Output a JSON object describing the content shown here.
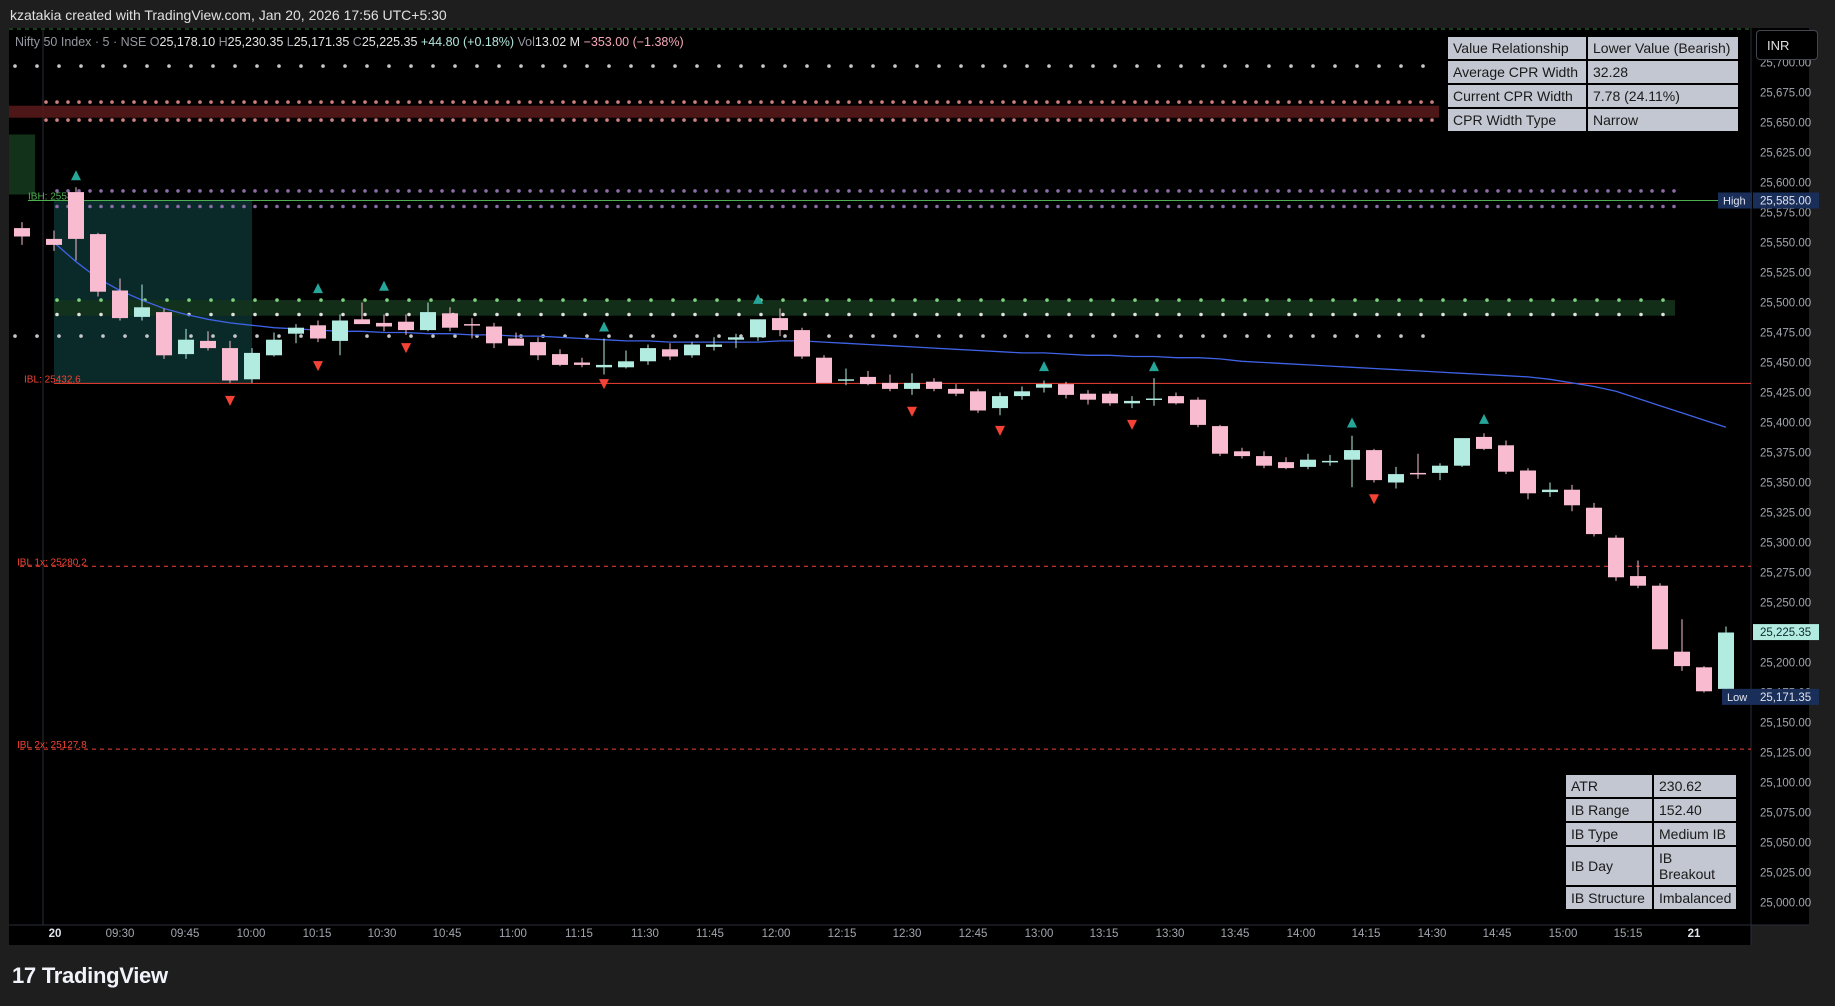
{
  "attribution": "kzatakia created with TradingView.com, Jan 20, 2026 17:56 UTC+5:30",
  "brand": "TradingView",
  "currency_button": "INR",
  "legend": {
    "symbol": "Nifty 50 Index · 5 · NSE",
    "o_label": "O",
    "o": "25,178.10",
    "h_label": "H",
    "h": "25,230.35",
    "l_label": "L",
    "l": "25,171.35",
    "c_label": "C",
    "c": "25,225.35",
    "change": "+44.80 (+0.18%)",
    "vol_label": "Vol",
    "vol": "13.02 M",
    "vol_change": "−353.00 (−1.38%)"
  },
  "cpr_table": [
    {
      "key": "Value Relationship",
      "value": "Lower Value (Bearish)"
    },
    {
      "key": "Average CPR Width",
      "value": "32.28"
    },
    {
      "key": "Current CPR Width",
      "value": "7.78 (24.11%)"
    },
    {
      "key": "CPR Width Type",
      "value": "Narrow"
    }
  ],
  "ib_table": [
    {
      "key": "ATR",
      "value": "230.62"
    },
    {
      "key": "IB Range",
      "value": "152.40"
    },
    {
      "key": "IB Type",
      "value": "Medium IB"
    },
    {
      "key": "IB Day",
      "value": "IB Breakout"
    },
    {
      "key": "IB Structure",
      "value": "Imbalanced"
    }
  ],
  "colors": {
    "background": "#000000",
    "up_candle": "#b2ebe0",
    "down_candle": "#f8bbd0",
    "ema": "#3f63e6",
    "ib_high": "#4caf50",
    "ib_low": "#f44336",
    "buy_arrow": "#26a69a",
    "sell_arrow": "#f44336",
    "ib_box": "#0d3838"
  },
  "chart_data": {
    "type": "candlestick",
    "symbol": "Nifty 50 Index",
    "interval": "5",
    "exchange": "NSE",
    "y_axis_ticks": [
      "25,700.00",
      "25,675.00",
      "25,650.00",
      "25,625.00",
      "25,600.00",
      "25,575.00",
      "25,550.00",
      "25,525.00",
      "25,500.00",
      "25,475.00",
      "25,450.00",
      "25,425.00",
      "25,400.00",
      "25,375.00",
      "25,350.00",
      "25,325.00",
      "25,300.00",
      "25,275.00",
      "25,250.00",
      "25,225.00",
      "25,200.00",
      "25,175.00",
      "25,150.00",
      "25,125.00",
      "25,100.00",
      "25,075.00",
      "25,050.00",
      "25,025.00",
      "25,000.00"
    ],
    "ylim": [
      24995,
      25725
    ],
    "x_axis_ticks": [
      "20",
      "09:30",
      "09:45",
      "10:00",
      "10:15",
      "10:30",
      "10:45",
      "11:00",
      "11:15",
      "11:30",
      "11:45",
      "12:00",
      "12:15",
      "12:30",
      "12:45",
      "13:00",
      "13:15",
      "13:30",
      "13:45",
      "14:00",
      "14:15",
      "14:30",
      "14:45",
      "15:00",
      "15:15",
      "21"
    ],
    "candles": [
      {
        "o": 25562,
        "h": 25567,
        "l": 25548,
        "c": 25555
      },
      {
        "o": 25553,
        "h": 25560,
        "l": 25543,
        "c": 25548
      },
      {
        "o": 25592,
        "h": 25596,
        "l": 25535,
        "c": 25553
      },
      {
        "o": 25557,
        "h": 25558,
        "l": 25505,
        "c": 25509
      },
      {
        "o": 25510,
        "h": 25520,
        "l": 25485,
        "c": 25487
      },
      {
        "o": 25488,
        "h": 25515,
        "l": 25485,
        "c": 25496
      },
      {
        "o": 25492,
        "h": 25495,
        "l": 25453,
        "c": 25456
      },
      {
        "o": 25457,
        "h": 25478,
        "l": 25453,
        "c": 25469
      },
      {
        "o": 25468,
        "h": 25476,
        "l": 25460,
        "c": 25462
      },
      {
        "o": 25462,
        "h": 25468,
        "l": 25433,
        "c": 25435
      },
      {
        "o": 25436,
        "h": 25462,
        "l": 25433,
        "c": 25458
      },
      {
        "o": 25456,
        "h": 25475,
        "l": 25455,
        "c": 25469
      },
      {
        "o": 25474,
        "h": 25482,
        "l": 25466,
        "c": 25479
      },
      {
        "o": 25481,
        "h": 25485,
        "l": 25467,
        "c": 25470
      },
      {
        "o": 25468,
        "h": 25490,
        "l": 25456,
        "c": 25485
      },
      {
        "o": 25486,
        "h": 25500,
        "l": 25485,
        "c": 25482
      },
      {
        "o": 25483,
        "h": 25490,
        "l": 25476,
        "c": 25480
      },
      {
        "o": 25484,
        "h": 25490,
        "l": 25473,
        "c": 25477
      },
      {
        "o": 25477,
        "h": 25500,
        "l": 25476,
        "c": 25492
      },
      {
        "o": 25491,
        "h": 25496,
        "l": 25476,
        "c": 25479
      },
      {
        "o": 25482,
        "h": 25487,
        "l": 25470,
        "c": 25481
      },
      {
        "o": 25480,
        "h": 25483,
        "l": 25462,
        "c": 25466
      },
      {
        "o": 25470,
        "h": 25475,
        "l": 25465,
        "c": 25464
      },
      {
        "o": 25467,
        "h": 25471,
        "l": 25452,
        "c": 25456
      },
      {
        "o": 25457,
        "h": 25461,
        "l": 25447,
        "c": 25448
      },
      {
        "o": 25450,
        "h": 25454,
        "l": 25446,
        "c": 25448
      },
      {
        "o": 25446,
        "h": 25470,
        "l": 25440,
        "c": 25448
      },
      {
        "o": 25446,
        "h": 25460,
        "l": 25445,
        "c": 25451
      },
      {
        "o": 25451,
        "h": 25465,
        "l": 25448,
        "c": 25462
      },
      {
        "o": 25461,
        "h": 25466,
        "l": 25452,
        "c": 25455
      },
      {
        "o": 25456,
        "h": 25467,
        "l": 25454,
        "c": 25465
      },
      {
        "o": 25463,
        "h": 25471,
        "l": 25460,
        "c": 25465
      },
      {
        "o": 25469,
        "h": 25474,
        "l": 25462,
        "c": 25471
      },
      {
        "o": 25471,
        "h": 25480,
        "l": 25468,
        "c": 25486
      },
      {
        "o": 25487,
        "h": 25495,
        "l": 25472,
        "c": 25477
      },
      {
        "o": 25477,
        "h": 25479,
        "l": 25453,
        "c": 25455
      },
      {
        "o": 25454,
        "h": 25456,
        "l": 25433,
        "c": 25433
      },
      {
        "o": 25435,
        "h": 25445,
        "l": 25431,
        "c": 25436
      },
      {
        "o": 25438,
        "h": 25443,
        "l": 25431,
        "c": 25432
      },
      {
        "o": 25433,
        "h": 25440,
        "l": 25426,
        "c": 25428
      },
      {
        "o": 25428,
        "h": 25441,
        "l": 25423,
        "c": 25433
      },
      {
        "o": 25434,
        "h": 25437,
        "l": 25426,
        "c": 25428
      },
      {
        "o": 25428,
        "h": 25432,
        "l": 25422,
        "c": 25424
      },
      {
        "o": 25426,
        "h": 25428,
        "l": 25408,
        "c": 25410
      },
      {
        "o": 25412,
        "h": 25425,
        "l": 25406,
        "c": 25422
      },
      {
        "o": 25422,
        "h": 25430,
        "l": 25419,
        "c": 25426
      },
      {
        "o": 25429,
        "h": 25435,
        "l": 25425,
        "c": 25432
      },
      {
        "o": 25432,
        "h": 25434,
        "l": 25420,
        "c": 25423
      },
      {
        "o": 25424,
        "h": 25427,
        "l": 25415,
        "c": 25419
      },
      {
        "o": 25424,
        "h": 25426,
        "l": 25414,
        "c": 25416
      },
      {
        "o": 25416,
        "h": 25422,
        "l": 25412,
        "c": 25418
      },
      {
        "o": 25419,
        "h": 25437,
        "l": 25414,
        "c": 25420
      },
      {
        "o": 25422,
        "h": 25425,
        "l": 25415,
        "c": 25416
      },
      {
        "o": 25419,
        "h": 25421,
        "l": 25396,
        "c": 25398
      },
      {
        "o": 25397,
        "h": 25398,
        "l": 25372,
        "c": 25374
      },
      {
        "o": 25376,
        "h": 25379,
        "l": 25370,
        "c": 25372
      },
      {
        "o": 25372,
        "h": 25376,
        "l": 25362,
        "c": 25364
      },
      {
        "o": 25367,
        "h": 25371,
        "l": 25361,
        "c": 25362
      },
      {
        "o": 25363,
        "h": 25374,
        "l": 25361,
        "c": 25369
      },
      {
        "o": 25368,
        "h": 25373,
        "l": 25364,
        "c": 25368
      },
      {
        "o": 25369,
        "h": 25389,
        "l": 25346,
        "c": 25377
      },
      {
        "o": 25377,
        "h": 25378,
        "l": 25350,
        "c": 25352
      },
      {
        "o": 25350,
        "h": 25363,
        "l": 25345,
        "c": 25357
      },
      {
        "o": 25358,
        "h": 25374,
        "l": 25353,
        "c": 25357
      },
      {
        "o": 25358,
        "h": 25366,
        "l": 25352,
        "c": 25364
      },
      {
        "o": 25364,
        "h": 25386,
        "l": 25363,
        "c": 25387
      },
      {
        "o": 25388,
        "h": 25391,
        "l": 25377,
        "c": 25378
      },
      {
        "o": 25381,
        "h": 25385,
        "l": 25357,
        "c": 25359
      },
      {
        "o": 25360,
        "h": 25362,
        "l": 25336,
        "c": 25341
      },
      {
        "o": 25342,
        "h": 25350,
        "l": 25338,
        "c": 25344
      },
      {
        "o": 25344,
        "h": 25348,
        "l": 25326,
        "c": 25331
      },
      {
        "o": 25329,
        "h": 25333,
        "l": 25305,
        "c": 25307
      },
      {
        "o": 25304,
        "h": 25306,
        "l": 25268,
        "c": 25271
      },
      {
        "o": 25272,
        "h": 25285,
        "l": 25262,
        "c": 25264
      },
      {
        "o": 25264,
        "h": 25266,
        "l": 25211,
        "c": 25211
      },
      {
        "o": 25209,
        "h": 25236,
        "l": 25193,
        "c": 25197
      },
      {
        "o": 25196,
        "h": 25197,
        "l": 25175,
        "c": 25176
      },
      {
        "o": 25178,
        "h": 25230,
        "l": 25171,
        "c": 25225
      }
    ],
    "ema": [
      25550,
      25534,
      25520,
      25510,
      25502,
      25495,
      25490,
      25486,
      25483,
      25481,
      25479,
      25478,
      25477,
      25476,
      25476,
      25475,
      25475,
      25474,
      25474,
      25473,
      25473,
      25472,
      25472,
      25471,
      25470,
      25469,
      25468,
      25468,
      25467,
      25467,
      25467,
      25467,
      25467,
      25468,
      25468,
      25467,
      25466,
      25465,
      25464,
      25463,
      25462,
      25461,
      25460,
      25459,
      25458,
      25458,
      25457,
      25456,
      25456,
      25455,
      25455,
      25454,
      25454,
      25453,
      25451,
      25450,
      25449,
      25448,
      25447,
      25446,
      25445,
      25444,
      25443,
      25442,
      25441,
      25440,
      25439,
      25438,
      25436,
      25433,
      25430,
      25426,
      25420,
      25414,
      25408,
      25402,
      25396
    ],
    "levels": {
      "ib_high_label": "IBH: 25585",
      "ib_high": 25585,
      "ib_low_label": "IBL: 25432.6",
      "ib_low": 25432.6,
      "ibl_1x_label": "IBL 1x: 25280.2",
      "ibl_1x": 25280.2,
      "ibl_2x_label": "IBL 2x: 25127.8",
      "ibl_2x": 25127.8
    },
    "price_tags": {
      "high_label": "High",
      "high_value": "25,585.00",
      "last_value": "25,225.35",
      "low_label": "Low",
      "low_value": "25,171.35"
    },
    "cpr_zones": [
      25654,
      25664,
      25489,
      25502
    ],
    "dotted_levels": [
      25697,
      25660,
      25497,
      25490,
      25476,
      25581,
      25591
    ],
    "buy_signals": [
      {
        "bar": 2,
        "price": 25606
      },
      {
        "bar": 13,
        "price": 25512
      },
      {
        "bar": 16,
        "price": 25514
      },
      {
        "bar": 26,
        "price": 25480
      },
      {
        "bar": 33,
        "price": 25503
      },
      {
        "bar": 46,
        "price": 25447
      },
      {
        "bar": 51,
        "price": 25447
      },
      {
        "bar": 60,
        "price": 25400
      },
      {
        "bar": 66,
        "price": 25403
      }
    ],
    "sell_signals": [
      {
        "bar": 9,
        "price": 25418
      },
      {
        "bar": 13,
        "price": 25447
      },
      {
        "bar": 17,
        "price": 25462
      },
      {
        "bar": 26,
        "price": 25432
      },
      {
        "bar": 40,
        "price": 25409
      },
      {
        "bar": 44,
        "price": 25393
      },
      {
        "bar": 50,
        "price": 25398
      },
      {
        "bar": 61,
        "price": 25336
      }
    ]
  }
}
